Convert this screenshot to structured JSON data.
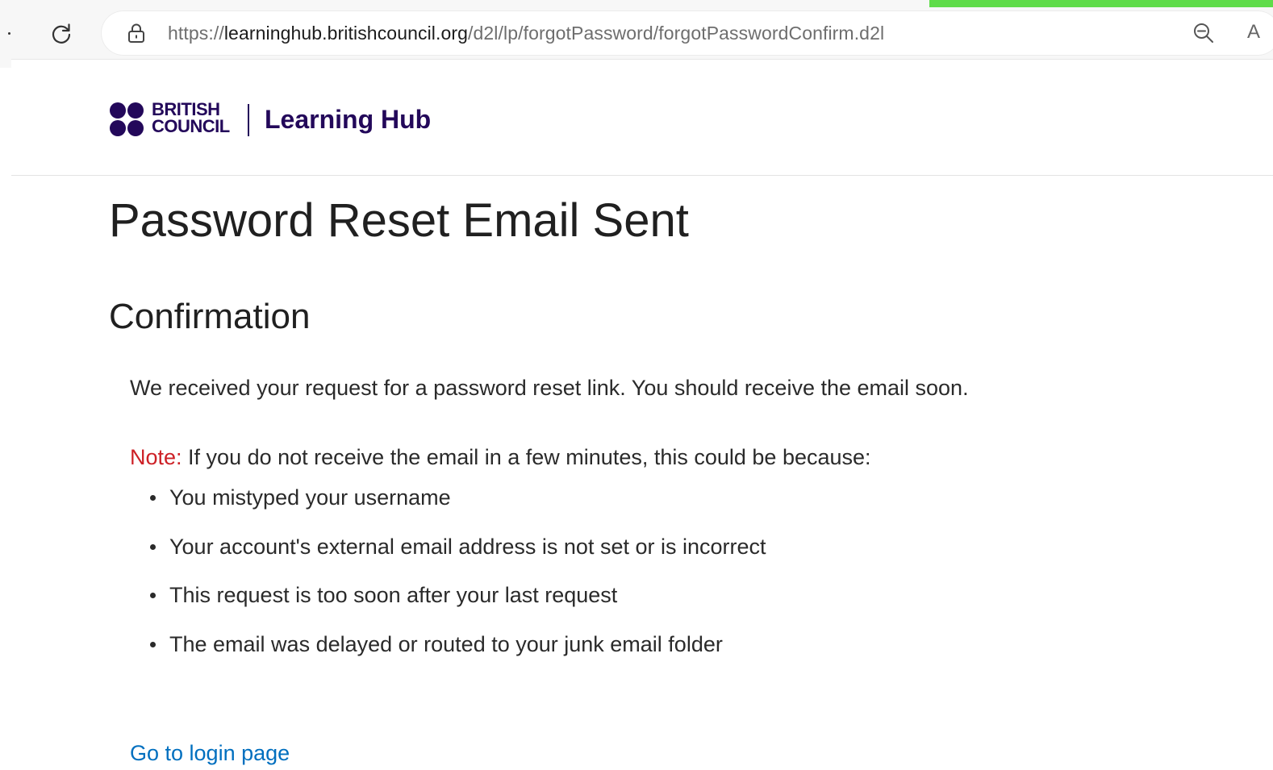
{
  "browser": {
    "url_scheme": "https://",
    "url_host": "learninghub.britishcouncil.org",
    "url_path": "/d2l/lp/forgotPassword/forgotPasswordConfirm.d2l",
    "reload_icon": "reload-icon",
    "lock_icon": "lock-icon",
    "zoom_icon": "zoom-out-icon",
    "read_aloud_glyph": "A",
    "loading_bar_color": "#5fdc4a"
  },
  "header": {
    "logo_line1": "BRITISH",
    "logo_line2": "COUNCIL",
    "hub_name": "Learning Hub",
    "brand_color": "#23085a"
  },
  "main": {
    "title": "Password Reset Email Sent",
    "section_heading": "Confirmation",
    "message": "We received your request for a password reset link. You should receive the email soon.",
    "note_label": "Note:",
    "note_color": "#cd2026",
    "note_text": " If you do not receive the email in a few minutes, this could be because:",
    "reasons": [
      "You mistyped your username",
      "Your account's external email address is not set or is incorrect",
      "This request is too soon after your last request",
      "The email was delayed or routed to your junk email folder"
    ],
    "login_link": "Go to login page",
    "link_color": "#006fbf"
  }
}
